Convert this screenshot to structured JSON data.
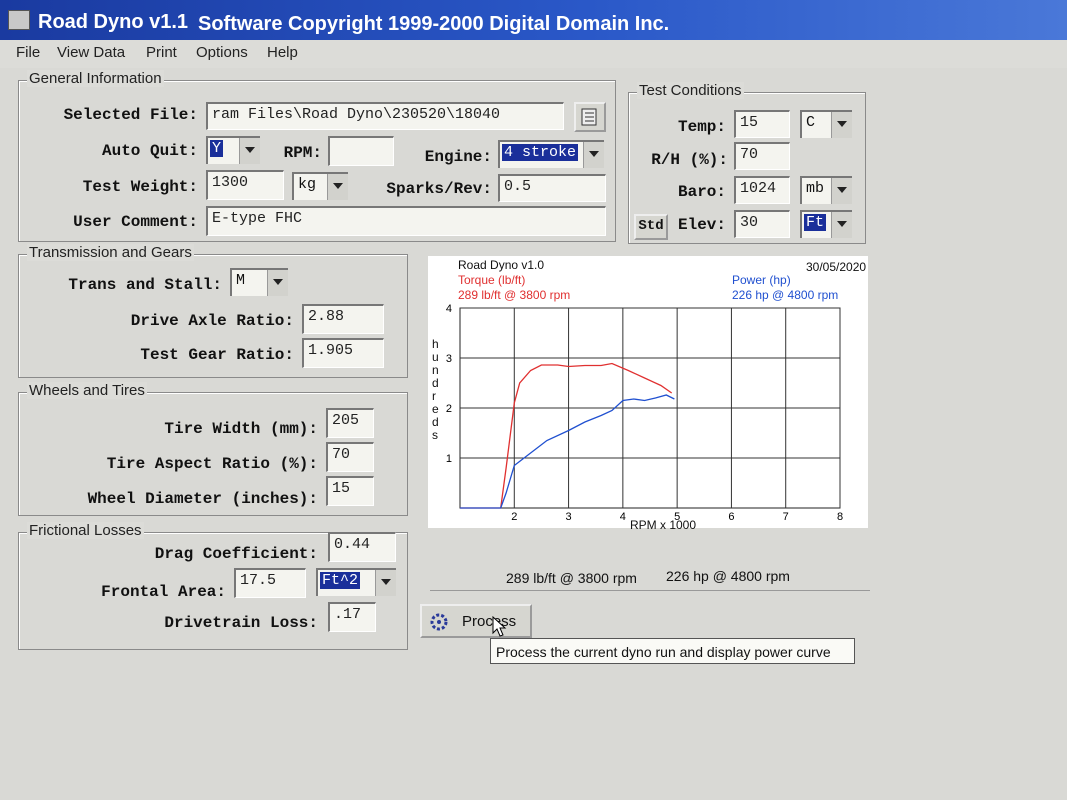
{
  "window": {
    "title": "Road Dyno v1.1",
    "copyright": "Software Copyright 1999-2000  Digital Domain Inc."
  },
  "menu": [
    "File",
    "View Data",
    "Print",
    "Options",
    "Help"
  ],
  "general": {
    "label": "General Information",
    "selected_file_label": "Selected File:",
    "selected_file_value": "ram Files\\Road Dyno\\230520\\18040",
    "auto_quit_label": "Auto Quit:",
    "auto_quit_value": "Y",
    "rpm_label": "RPM:",
    "rpm_value": "",
    "engine_label": "Engine:",
    "engine_value": "4 stroke",
    "test_weight_label": "Test Weight:",
    "test_weight_value": "1300",
    "weight_unit": "kg",
    "sparks_label": "Sparks/Rev:",
    "sparks_value": "0.5",
    "user_comment_label": "User Comment:",
    "user_comment_value": "E-type FHC"
  },
  "test_conditions": {
    "label": "Test Conditions",
    "temp_label": "Temp:",
    "temp_value": "15",
    "temp_unit": "C",
    "rh_label": "R/H (%):",
    "rh_value": "70",
    "baro_label": "Baro:",
    "baro_value": "1024",
    "baro_unit": "mb",
    "std_button": "Std",
    "elev_label": "Elev:",
    "elev_value": "30",
    "elev_unit": "Ft"
  },
  "transmission": {
    "label": "Transmission and Gears",
    "trans_label": "Trans and Stall:",
    "trans_value": "M",
    "axle_label": "Drive Axle Ratio:",
    "axle_value": "2.88",
    "gear_label": "Test Gear Ratio:",
    "gear_value": "1.905"
  },
  "wheels": {
    "label": "Wheels and Tires",
    "width_label": "Tire Width (mm):",
    "width_value": "205",
    "aspect_label": "Tire Aspect Ratio (%):",
    "aspect_value": "70",
    "diameter_label": "Wheel Diameter (inches):",
    "diameter_value": "15"
  },
  "friction": {
    "label": "Frictional Losses",
    "drag_label": "Drag Coefficient:",
    "drag_value": "0.44",
    "area_label": "Frontal Area:",
    "area_value": "17.5",
    "area_unit": "Ft^2",
    "loss_label": "Drivetrain Loss:",
    "loss_value": ".17"
  },
  "chart_header": {
    "app": "Road Dyno v1.0",
    "date": "30/05/2020",
    "torque_label": "Torque (lb/ft)",
    "torque_peak": "289 lb/ft @  3800 rpm",
    "power_label": "Power (hp)",
    "power_peak": "226 hp @  4800 rpm",
    "y_label": "hundreds",
    "x_label": "RPM x 1000"
  },
  "chart_data": {
    "type": "line",
    "xlabel": "RPM x 1000",
    "ylabel": "hundreds",
    "xlim": [
      1,
      8
    ],
    "ylim": [
      0,
      4
    ],
    "x_ticks": [
      2,
      3,
      4,
      5,
      6,
      7,
      8
    ],
    "y_ticks": [
      1,
      2,
      3,
      4
    ],
    "grid": true,
    "colors": {
      "torque": "#e03030",
      "power": "#2050d0"
    },
    "series": [
      {
        "name": "Torque (lb/ft)",
        "x": [
          1.0,
          1.75,
          1.85,
          2.0,
          2.1,
          2.3,
          2.5,
          2.8,
          3.0,
          3.3,
          3.6,
          3.8,
          4.1,
          4.4,
          4.7,
          4.9
        ],
        "y": [
          0,
          0,
          0.8,
          2.1,
          2.5,
          2.75,
          2.86,
          2.86,
          2.83,
          2.85,
          2.85,
          2.89,
          2.75,
          2.6,
          2.45,
          2.3
        ]
      },
      {
        "name": "Power (hp)",
        "x": [
          1.0,
          1.75,
          1.85,
          2.0,
          2.3,
          2.6,
          3.0,
          3.3,
          3.6,
          3.8,
          4.0,
          4.2,
          4.4,
          4.6,
          4.8,
          4.95
        ],
        "y": [
          0,
          0,
          0.3,
          0.85,
          1.1,
          1.35,
          1.55,
          1.72,
          1.85,
          1.95,
          2.15,
          2.18,
          2.15,
          2.2,
          2.26,
          2.18
        ]
      }
    ]
  },
  "summary": {
    "torque": "289 lb/ft @   3800 rpm",
    "power": "226 hp @   4800 rpm"
  },
  "process_button": "Process",
  "tooltip": "Process the current dyno run and display power curve"
}
